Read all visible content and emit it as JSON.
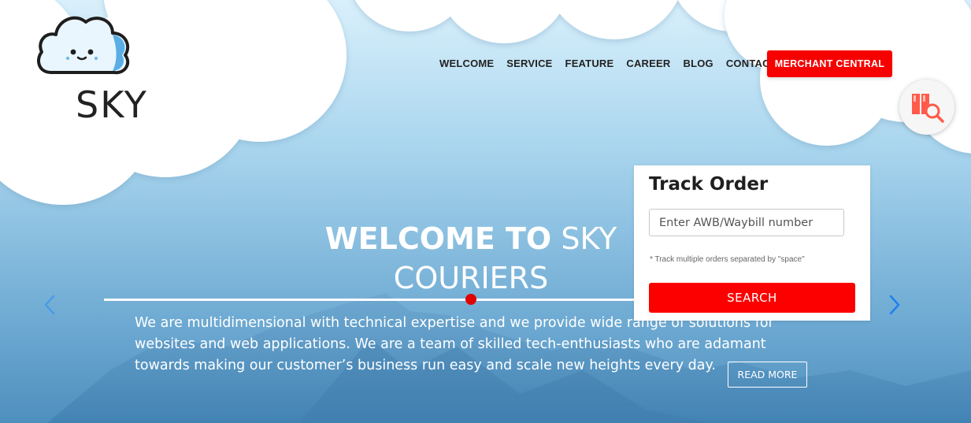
{
  "brand": {
    "name": "SKY"
  },
  "nav": {
    "items": [
      {
        "label": "WELCOME"
      },
      {
        "label": "SERVICE"
      },
      {
        "label": "FEATURE"
      },
      {
        "label": "CAREER"
      },
      {
        "label": "BLOG"
      },
      {
        "label": "CONTACT"
      }
    ],
    "cta": "MERCHANT CENTRAL"
  },
  "hero": {
    "title_strong": "WELCOME TO",
    "title_light_1": "SKY",
    "title_light_2": "COURIERS",
    "description": "We are multidimensional with technical expertise and we provide wide range of solutions for websites and web applications. We are a team of skilled tech-enthusiasts who are adamant towards making our customer’s business run easy and scale new heights every day.",
    "read_more": "READ MORE"
  },
  "track": {
    "title": "Track Order",
    "placeholder": "Enter AWB/Waybill number",
    "hint": "* Track multiple orders separated by \"space\"",
    "button": "SEARCH"
  },
  "colors": {
    "accent": "#f70000",
    "arrow": "#1f7ff0",
    "sky_top": "#c5e7f7",
    "sky_bottom": "#5a9cc6"
  },
  "icons": {
    "prev": "chevron-left-icon",
    "next": "chevron-right-icon",
    "floating": "track-shipment-icon",
    "logo": "cloud-face-icon"
  }
}
